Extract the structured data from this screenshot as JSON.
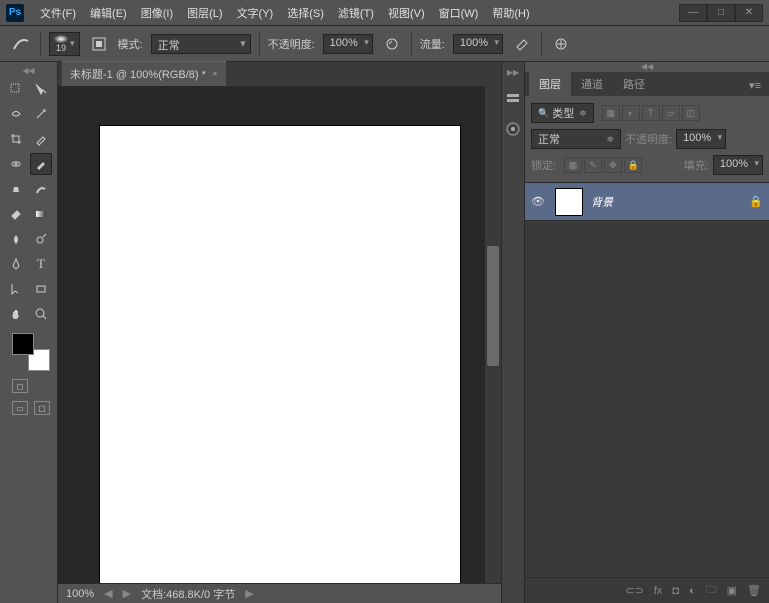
{
  "app": {
    "logo": "Ps"
  },
  "menu": [
    "文件(F)",
    "编辑(E)",
    "图像(I)",
    "图层(L)",
    "文字(Y)",
    "选择(S)",
    "滤镜(T)",
    "视图(V)",
    "窗口(W)",
    "帮助(H)"
  ],
  "options": {
    "brush_size": "19",
    "mode_label": "模式:",
    "mode_value": "正常",
    "opacity_label": "不透明度:",
    "opacity_value": "100%",
    "flow_label": "流量:",
    "flow_value": "100%"
  },
  "document": {
    "tab_title": "未标题-1 @ 100%(RGB/8) *",
    "zoom": "100%",
    "status": "文档:468.8K/0 字节"
  },
  "panels": {
    "tabs": [
      "图层",
      "通道",
      "路径"
    ],
    "filter_label": "类型",
    "blend_mode": "正常",
    "opacity_label": "不透明度:",
    "opacity_value": "100%",
    "lock_label": "锁定:",
    "fill_label": "填充:",
    "fill_value": "100%",
    "layer": {
      "name": "背景"
    }
  },
  "colors": {
    "fg": "#000000",
    "bg": "#ffffff"
  }
}
